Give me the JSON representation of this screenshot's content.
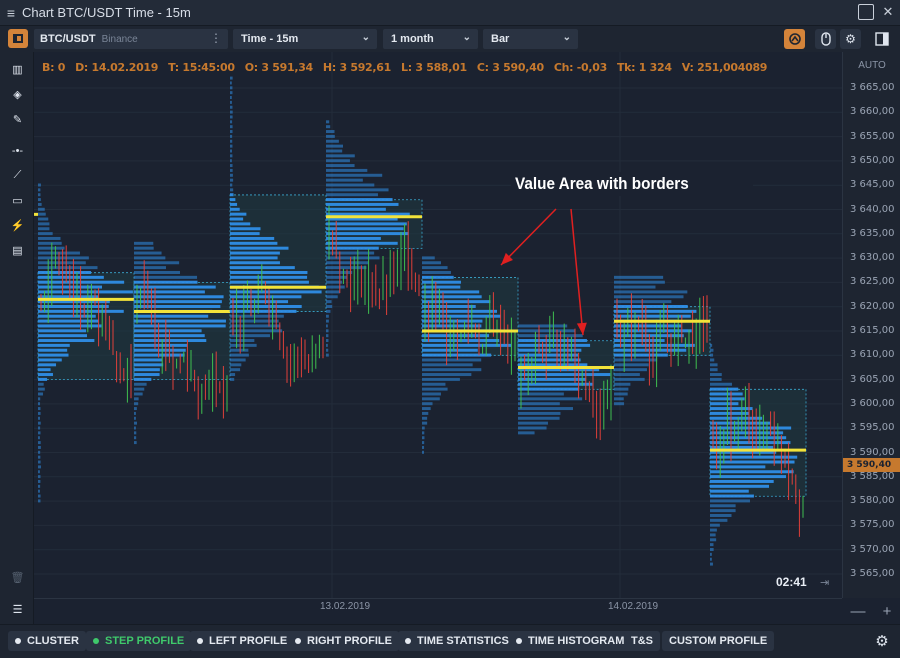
{
  "window": {
    "title": "Chart BTC/USDT Time - 15m"
  },
  "toolbar": {
    "symbol": "BTC/USDT",
    "exchange": "Binance",
    "timeframe": "Time - 15m",
    "period": "1 month",
    "chart_type": "Bar"
  },
  "info_line": [
    "B: 0",
    "D: 14.02.2019",
    "T: 15:45:00",
    "O: 3 591,34",
    "H: 3 592,61",
    "L: 3 588,01",
    "C: 3 590,40",
    "Ch: -0,03",
    "Tk: 1 324",
    "V: 251,004089"
  ],
  "y_axis": {
    "scale_mode": "AUTO",
    "ticks": [
      "3 665,00",
      "3 660,00",
      "3 655,00",
      "3 650,00",
      "3 645,00",
      "3 640,00",
      "3 635,00",
      "3 630,00",
      "3 625,00",
      "3 620,00",
      "3 615,00",
      "3 610,00",
      "3 605,00",
      "3 600,00",
      "3 595,00",
      "3 590,00",
      "3 585,00",
      "3 580,00",
      "3 575,00",
      "3 570,00",
      "3 565,00"
    ],
    "current_price": "3 590,40"
  },
  "x_axis": {
    "ticks": [
      "13.02.2019",
      "14.02.2019"
    ]
  },
  "annotation": "Value Area with borders",
  "timer": "02:41",
  "bottom_tabs": [
    {
      "label": "CLUSTER",
      "active": false
    },
    {
      "label": "STEP PROFILE",
      "active": true
    },
    {
      "label": "LEFT PROFILE",
      "active": false
    },
    {
      "label": "RIGHT PROFILE",
      "active": false
    },
    {
      "label": "TIME STATISTICS",
      "active": false
    },
    {
      "label": "TIME HISTOGRAM",
      "active": false
    },
    {
      "label": "T&S",
      "active": false
    },
    {
      "label": "CUSTOM PROFILE",
      "active": false
    }
  ],
  "colors": {
    "background": "#1b2230",
    "profile_bar": "#2f8ee6",
    "poc_line": "#f2e33a",
    "value_area_border": "#3aa9d0",
    "candle_up": "#3fbf4f",
    "candle_down": "#e0403a",
    "accent": "#c6792e",
    "annotation_arrow": "#e02020"
  },
  "chart_data": {
    "type": "volume-profile",
    "symbol": "BTC/USDT",
    "timeframe": "15m",
    "y_unit": "price",
    "ylim": [
      3563,
      3669
    ],
    "profiles": [
      {
        "poc": 3621.5,
        "value_area": [
          3605,
          3627
        ],
        "low": 3580,
        "high": 3645
      },
      {
        "poc": 3619.0,
        "value_area": [
          3605,
          3625
        ],
        "low": 3592,
        "high": 3633
      },
      {
        "poc": 3624.0,
        "value_area": [
          3619,
          3643
        ],
        "low": 3605,
        "high": 3667
      },
      {
        "poc": 3638.5,
        "value_area": [
          3632,
          3642
        ],
        "low": 3610,
        "high": 3658
      },
      {
        "poc": 3615.0,
        "value_area": [
          3610,
          3626
        ],
        "low": 3590,
        "high": 3630
      },
      {
        "poc": 3607.5,
        "value_area": [
          3603,
          3613
        ],
        "low": 3594,
        "high": 3616
      },
      {
        "poc": 3617.0,
        "value_area": [
          3610,
          3620
        ],
        "low": 3600,
        "high": 3626
      },
      {
        "poc": 3590.5,
        "value_area": [
          3581,
          3603
        ],
        "low": 3567,
        "high": 3612
      }
    ],
    "last_close": 3590.4
  }
}
